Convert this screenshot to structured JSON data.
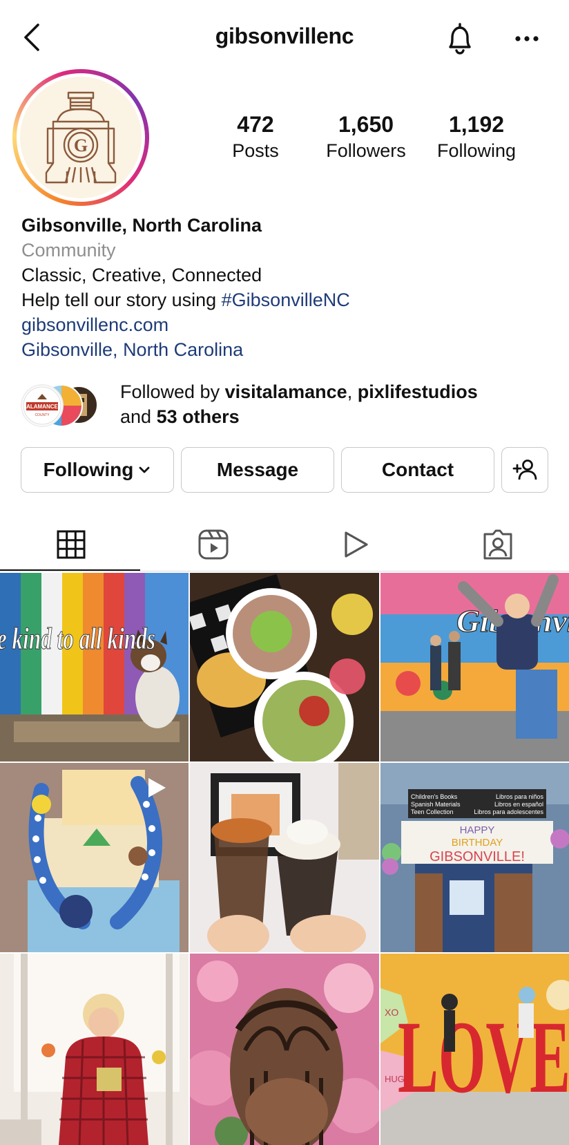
{
  "header": {
    "username": "gibsonvillenc",
    "back_icon": "chevron-left-icon",
    "bell_icon": "bell-icon",
    "more_icon": "more-horizontal-icon"
  },
  "profile": {
    "stats": [
      {
        "value": "472",
        "label": "Posts"
      },
      {
        "value": "1,650",
        "label": "Followers"
      },
      {
        "value": "1,192",
        "label": "Following"
      }
    ],
    "name": "Gibsonville, North Carolina",
    "category": "Community",
    "bio_line1": "Classic, Creative, Connected",
    "bio_line2_prefix": "Help tell our story using ",
    "bio_hashtag": "#GibsonvilleNC",
    "website": "gibsonvillenc.com",
    "location": "Gibsonville, North Carolina"
  },
  "followed_by": {
    "prefix": "Followed by ",
    "user1": "visitalamance",
    "separator": ", ",
    "user2": "pixlifestudios",
    "and": "and ",
    "others": "53 others",
    "avatar_text": "ALAMANCE",
    "avatar_subtext": "COUNTY"
  },
  "actions": {
    "following_label": "Following",
    "message_label": "Message",
    "contact_label": "Contact",
    "add_person_icon": "add-person-icon"
  },
  "tabs": [
    {
      "name": "grid",
      "icon": "grid-icon",
      "active": true
    },
    {
      "name": "reels",
      "icon": "reels-icon",
      "active": false
    },
    {
      "name": "videos",
      "icon": "play-icon",
      "active": false
    },
    {
      "name": "tagged",
      "icon": "tagged-person-icon",
      "active": false
    }
  ],
  "posts": {
    "p1_text": "Be kind to all kinds",
    "p3_text": "Gibsonville",
    "p6_sign1": "Children's Books",
    "p6_sign2": "Spanish Materials",
    "p6_sign3": "Teen Collection",
    "p6_sign4": "Libros para niños",
    "p6_sign5": "Libros en español",
    "p6_sign6": "Libros para adolescentes",
    "p6_banner1": "HAPPY",
    "p6_banner2": "BIRTHDAY",
    "p6_banner3": "GIBSONVILLE!",
    "p9_text": "LOVE",
    "p9_heart1": "XO",
    "p9_heart2": "HUGS"
  },
  "colors": {
    "link": "#1e3b78",
    "secondary_text": "#8e8e8e",
    "border": "#c8c8c8"
  }
}
